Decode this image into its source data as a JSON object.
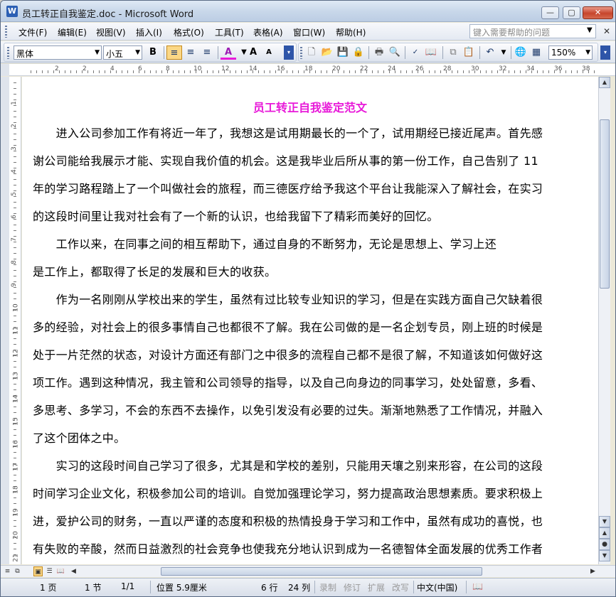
{
  "window": {
    "title": "员工转正自我鉴定.doc - Microsoft Word",
    "app_icon": "word-icon"
  },
  "menu": {
    "items": [
      "文件(F)",
      "编辑(E)",
      "视图(V)",
      "插入(I)",
      "格式(O)",
      "工具(T)",
      "表格(A)",
      "窗口(W)",
      "帮助(H)"
    ],
    "help_placeholder": "键入需要帮助的问题"
  },
  "toolbar": {
    "font_name": "黑体",
    "font_size": "小五",
    "zoom": "150%",
    "icons": [
      "bold-icon",
      "align-left-icon",
      "align-center-icon",
      "align-right-icon",
      "font-color-icon",
      "grow-font-icon",
      "shrink-font-icon",
      "new-doc-icon",
      "open-icon",
      "save-icon",
      "permission-icon",
      "print-icon",
      "print-preview-icon",
      "spelling-icon",
      "research-icon",
      "copy-icon",
      "paste-icon",
      "undo-icon",
      "hyperlink-icon",
      "table-icon"
    ],
    "bold_label": "B",
    "font_color_label": "A",
    "grow_label": "A",
    "shrink_label": "A"
  },
  "document": {
    "title": "员工转正自我鉴定范文",
    "lines": [
      "　　进入公司参加工作有将近一年了，我想这是试用期最长的一个了，试用期经已接近尾声。首先感",
      "谢公司能给我展示才能、实现自我价值的机会。这是我毕业后所从事的第一份工作，自己告别了 11",
      "年的学习路程踏上了一个叫做社会的旅程，而三德医疗给予我这个平台让我能深入了解社会，在实习",
      "的这段时间里让我对社会有了一个新的认识，也给我留下了精彩而美好的回忆。",
      "　　工作以来，在同事之间的相互帮助下，通过自身的不断努力，无论是思想上、学习上还",
      "是工作上，都取得了长足的发展和巨大的收获。",
      "　　作为一名刚刚从学校出来的学生，虽然有过比较专业知识的学习，但是在实践方面自己欠缺着很",
      "多的经验，对社会上的很多事情自己也都很不了解。我在公司做的是一名企划专员，刚上班的时候是",
      "处于一片茫然的状态，对设计方面还有部门之中很多的流程自己都不是很了解，不知道该如何做好这",
      "项工作。遇到这种情况，我主管和公司领导的指导，以及自己向身边的同事学习，处处留意，多看、",
      "多思考、多学习，不会的东西不去操作，以免引发没有必要的过失。渐渐地熟悉了工作情况，并融入",
      "了这个团体之中。",
      "　　实习的这段时间自己学习了很多，尤其是和学校的差别，只能用天壤之别来形容，在公司的这段",
      "时间学习企业文化，积极参加公司的培训。自觉加强理论学习，努力提高政治思想素质。要求积极上",
      "进，爱护公司的财务，一直以严谨的态度和积极的热情投身于学习和工作中，虽然有成功的喜悦，也",
      "有失败的辛酸，然而日益激烈的社会竞争也使我充分地认识到成为一名德智体全面发展的优秀工作者"
    ],
    "title_color": "#e81ad9"
  },
  "ruler": {
    "h_numbers": [
      "2",
      "2",
      "4",
      "6",
      "8",
      "10",
      "12",
      "14",
      "16",
      "18",
      "20",
      "22",
      "24",
      "26",
      "28",
      "30",
      "32",
      "34",
      "36",
      "38"
    ],
    "v_numbers": [
      "1",
      "2",
      "3",
      "4",
      "5",
      "6",
      "7",
      "8",
      "9",
      "10",
      "11",
      "12",
      "13",
      "14",
      "15",
      "16",
      "17",
      "18",
      "19",
      "20",
      "21"
    ]
  },
  "status": {
    "page": "1 页",
    "section": "1 节",
    "page_of": "1/1",
    "position": "位置 5.9厘米",
    "row": "6 行",
    "col": "24 列",
    "rec": "录制",
    "trk": "修订",
    "ext": "扩展",
    "ovr": "改写",
    "lang": "中文(中国)"
  }
}
